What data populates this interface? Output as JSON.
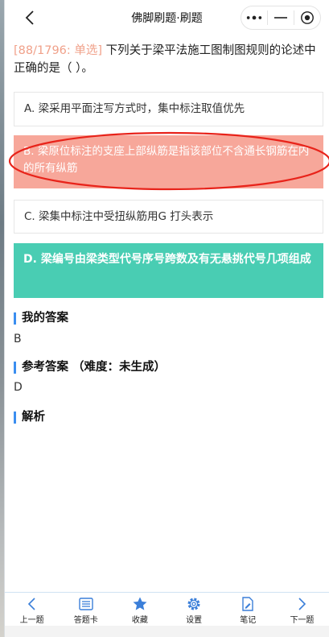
{
  "header": {
    "title": "佛脚刷题·刷题",
    "back_icon": "chevron-left-icon",
    "more_icon": "more-dots-icon",
    "minimize_icon": "minus-icon",
    "close_icon": "target-circle-icon"
  },
  "question": {
    "tag": "[88/1796: 单选]",
    "text": " 下列关于梁平法施工图制图规则的论述中正确的是（ ）。"
  },
  "options": [
    {
      "label": "A. 梁采用平面注写方式时，集中标注取值优先",
      "state": "normal"
    },
    {
      "label": "B. 梁原位标注的支座上部纵筋是指该部位不含通长钢筋在内的所有纵筋",
      "state": "wrong"
    },
    {
      "label": "C. 梁集中标注中受扭纵筋用G 打头表示",
      "state": "normal"
    },
    {
      "label": "D. 梁编号由梁类型代号序号跨数及有无悬挑代号几项组成",
      "state": "correct"
    }
  ],
  "my_answer": {
    "title": "我的答案",
    "value": "B"
  },
  "ref_answer": {
    "title": "参考答案 （难度：未生成）",
    "value": "D"
  },
  "analysis": {
    "title": "解析"
  },
  "tabbar": [
    {
      "label": "上一题",
      "icon": "chevron-left-icon"
    },
    {
      "label": "答题卡",
      "icon": "list-card-icon"
    },
    {
      "label": "收藏",
      "icon": "star-icon"
    },
    {
      "label": "设置",
      "icon": "gear-icon"
    },
    {
      "label": "笔记",
      "icon": "note-pen-icon"
    },
    {
      "label": "下一题",
      "icon": "chevron-right-icon"
    }
  ],
  "colors": {
    "wrong": "#f7a79a",
    "correct": "#49cdb3",
    "accent": "#3b8ef0",
    "annotation": "#e8231a"
  }
}
